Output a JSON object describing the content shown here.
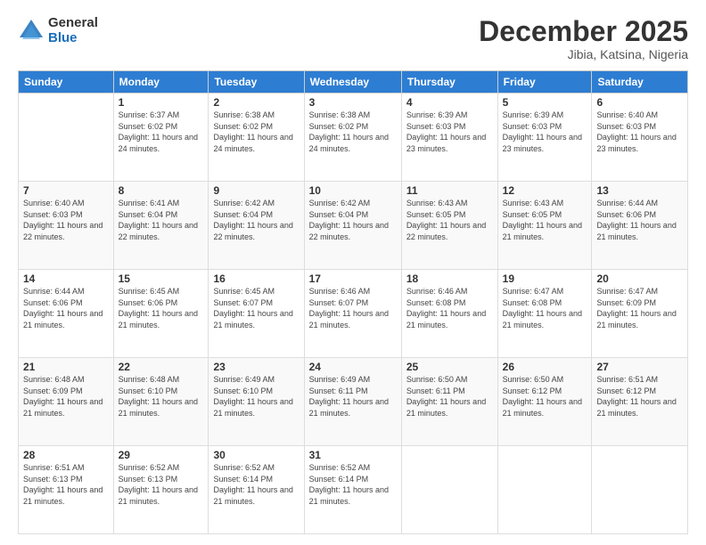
{
  "logo": {
    "general": "General",
    "blue": "Blue"
  },
  "header": {
    "title": "December 2025",
    "subtitle": "Jibia, Katsina, Nigeria"
  },
  "weekdays": [
    "Sunday",
    "Monday",
    "Tuesday",
    "Wednesday",
    "Thursday",
    "Friday",
    "Saturday"
  ],
  "weeks": [
    [
      {
        "day": "",
        "sunrise": "",
        "sunset": "",
        "daylight": ""
      },
      {
        "day": "1",
        "sunrise": "Sunrise: 6:37 AM",
        "sunset": "Sunset: 6:02 PM",
        "daylight": "Daylight: 11 hours and 24 minutes."
      },
      {
        "day": "2",
        "sunrise": "Sunrise: 6:38 AM",
        "sunset": "Sunset: 6:02 PM",
        "daylight": "Daylight: 11 hours and 24 minutes."
      },
      {
        "day": "3",
        "sunrise": "Sunrise: 6:38 AM",
        "sunset": "Sunset: 6:02 PM",
        "daylight": "Daylight: 11 hours and 24 minutes."
      },
      {
        "day": "4",
        "sunrise": "Sunrise: 6:39 AM",
        "sunset": "Sunset: 6:03 PM",
        "daylight": "Daylight: 11 hours and 23 minutes."
      },
      {
        "day": "5",
        "sunrise": "Sunrise: 6:39 AM",
        "sunset": "Sunset: 6:03 PM",
        "daylight": "Daylight: 11 hours and 23 minutes."
      },
      {
        "day": "6",
        "sunrise": "Sunrise: 6:40 AM",
        "sunset": "Sunset: 6:03 PM",
        "daylight": "Daylight: 11 hours and 23 minutes."
      }
    ],
    [
      {
        "day": "7",
        "sunrise": "Sunrise: 6:40 AM",
        "sunset": "Sunset: 6:03 PM",
        "daylight": "Daylight: 11 hours and 22 minutes."
      },
      {
        "day": "8",
        "sunrise": "Sunrise: 6:41 AM",
        "sunset": "Sunset: 6:04 PM",
        "daylight": "Daylight: 11 hours and 22 minutes."
      },
      {
        "day": "9",
        "sunrise": "Sunrise: 6:42 AM",
        "sunset": "Sunset: 6:04 PM",
        "daylight": "Daylight: 11 hours and 22 minutes."
      },
      {
        "day": "10",
        "sunrise": "Sunrise: 6:42 AM",
        "sunset": "Sunset: 6:04 PM",
        "daylight": "Daylight: 11 hours and 22 minutes."
      },
      {
        "day": "11",
        "sunrise": "Sunrise: 6:43 AM",
        "sunset": "Sunset: 6:05 PM",
        "daylight": "Daylight: 11 hours and 22 minutes."
      },
      {
        "day": "12",
        "sunrise": "Sunrise: 6:43 AM",
        "sunset": "Sunset: 6:05 PM",
        "daylight": "Daylight: 11 hours and 21 minutes."
      },
      {
        "day": "13",
        "sunrise": "Sunrise: 6:44 AM",
        "sunset": "Sunset: 6:06 PM",
        "daylight": "Daylight: 11 hours and 21 minutes."
      }
    ],
    [
      {
        "day": "14",
        "sunrise": "Sunrise: 6:44 AM",
        "sunset": "Sunset: 6:06 PM",
        "daylight": "Daylight: 11 hours and 21 minutes."
      },
      {
        "day": "15",
        "sunrise": "Sunrise: 6:45 AM",
        "sunset": "Sunset: 6:06 PM",
        "daylight": "Daylight: 11 hours and 21 minutes."
      },
      {
        "day": "16",
        "sunrise": "Sunrise: 6:45 AM",
        "sunset": "Sunset: 6:07 PM",
        "daylight": "Daylight: 11 hours and 21 minutes."
      },
      {
        "day": "17",
        "sunrise": "Sunrise: 6:46 AM",
        "sunset": "Sunset: 6:07 PM",
        "daylight": "Daylight: 11 hours and 21 minutes."
      },
      {
        "day": "18",
        "sunrise": "Sunrise: 6:46 AM",
        "sunset": "Sunset: 6:08 PM",
        "daylight": "Daylight: 11 hours and 21 minutes."
      },
      {
        "day": "19",
        "sunrise": "Sunrise: 6:47 AM",
        "sunset": "Sunset: 6:08 PM",
        "daylight": "Daylight: 11 hours and 21 minutes."
      },
      {
        "day": "20",
        "sunrise": "Sunrise: 6:47 AM",
        "sunset": "Sunset: 6:09 PM",
        "daylight": "Daylight: 11 hours and 21 minutes."
      }
    ],
    [
      {
        "day": "21",
        "sunrise": "Sunrise: 6:48 AM",
        "sunset": "Sunset: 6:09 PM",
        "daylight": "Daylight: 11 hours and 21 minutes."
      },
      {
        "day": "22",
        "sunrise": "Sunrise: 6:48 AM",
        "sunset": "Sunset: 6:10 PM",
        "daylight": "Daylight: 11 hours and 21 minutes."
      },
      {
        "day": "23",
        "sunrise": "Sunrise: 6:49 AM",
        "sunset": "Sunset: 6:10 PM",
        "daylight": "Daylight: 11 hours and 21 minutes."
      },
      {
        "day": "24",
        "sunrise": "Sunrise: 6:49 AM",
        "sunset": "Sunset: 6:11 PM",
        "daylight": "Daylight: 11 hours and 21 minutes."
      },
      {
        "day": "25",
        "sunrise": "Sunrise: 6:50 AM",
        "sunset": "Sunset: 6:11 PM",
        "daylight": "Daylight: 11 hours and 21 minutes."
      },
      {
        "day": "26",
        "sunrise": "Sunrise: 6:50 AM",
        "sunset": "Sunset: 6:12 PM",
        "daylight": "Daylight: 11 hours and 21 minutes."
      },
      {
        "day": "27",
        "sunrise": "Sunrise: 6:51 AM",
        "sunset": "Sunset: 6:12 PM",
        "daylight": "Daylight: 11 hours and 21 minutes."
      }
    ],
    [
      {
        "day": "28",
        "sunrise": "Sunrise: 6:51 AM",
        "sunset": "Sunset: 6:13 PM",
        "daylight": "Daylight: 11 hours and 21 minutes."
      },
      {
        "day": "29",
        "sunrise": "Sunrise: 6:52 AM",
        "sunset": "Sunset: 6:13 PM",
        "daylight": "Daylight: 11 hours and 21 minutes."
      },
      {
        "day": "30",
        "sunrise": "Sunrise: 6:52 AM",
        "sunset": "Sunset: 6:14 PM",
        "daylight": "Daylight: 11 hours and 21 minutes."
      },
      {
        "day": "31",
        "sunrise": "Sunrise: 6:52 AM",
        "sunset": "Sunset: 6:14 PM",
        "daylight": "Daylight: 11 hours and 21 minutes."
      },
      {
        "day": "",
        "sunrise": "",
        "sunset": "",
        "daylight": ""
      },
      {
        "day": "",
        "sunrise": "",
        "sunset": "",
        "daylight": ""
      },
      {
        "day": "",
        "sunrise": "",
        "sunset": "",
        "daylight": ""
      }
    ]
  ]
}
